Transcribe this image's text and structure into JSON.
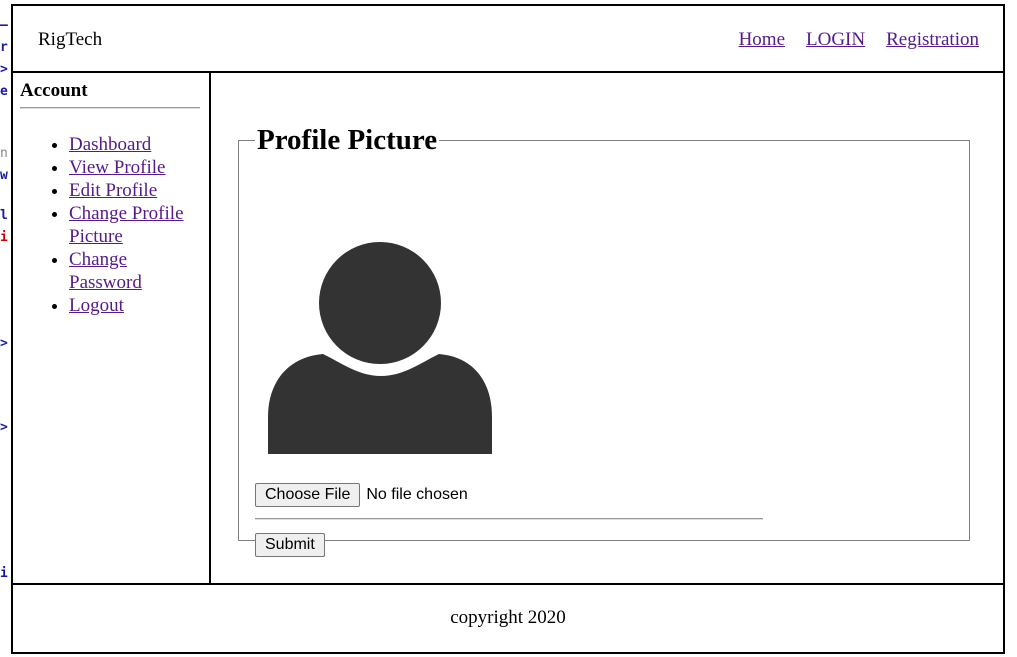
{
  "header": {
    "brand": "RigTech",
    "nav": [
      {
        "label": "Home"
      },
      {
        "label": "LOGIN"
      },
      {
        "label": "Registration"
      }
    ]
  },
  "sidebar": {
    "title": "Account",
    "items": [
      {
        "label": "Dashboard"
      },
      {
        "label": "View Profile"
      },
      {
        "label": "Edit Profile"
      },
      {
        "label": "Change Profile Picture"
      },
      {
        "label": "Change Password"
      },
      {
        "label": "Logout"
      }
    ]
  },
  "main": {
    "legend": "Profile Picture",
    "avatar_icon": "user-silhouette-icon",
    "file_button_label": "Choose File",
    "file_status": "No file chosen",
    "submit_label": "Submit"
  },
  "footer": {
    "text": "copyright 2020"
  },
  "colors": {
    "link": "#551a8b",
    "avatar": "#333333",
    "border": "#000000"
  }
}
